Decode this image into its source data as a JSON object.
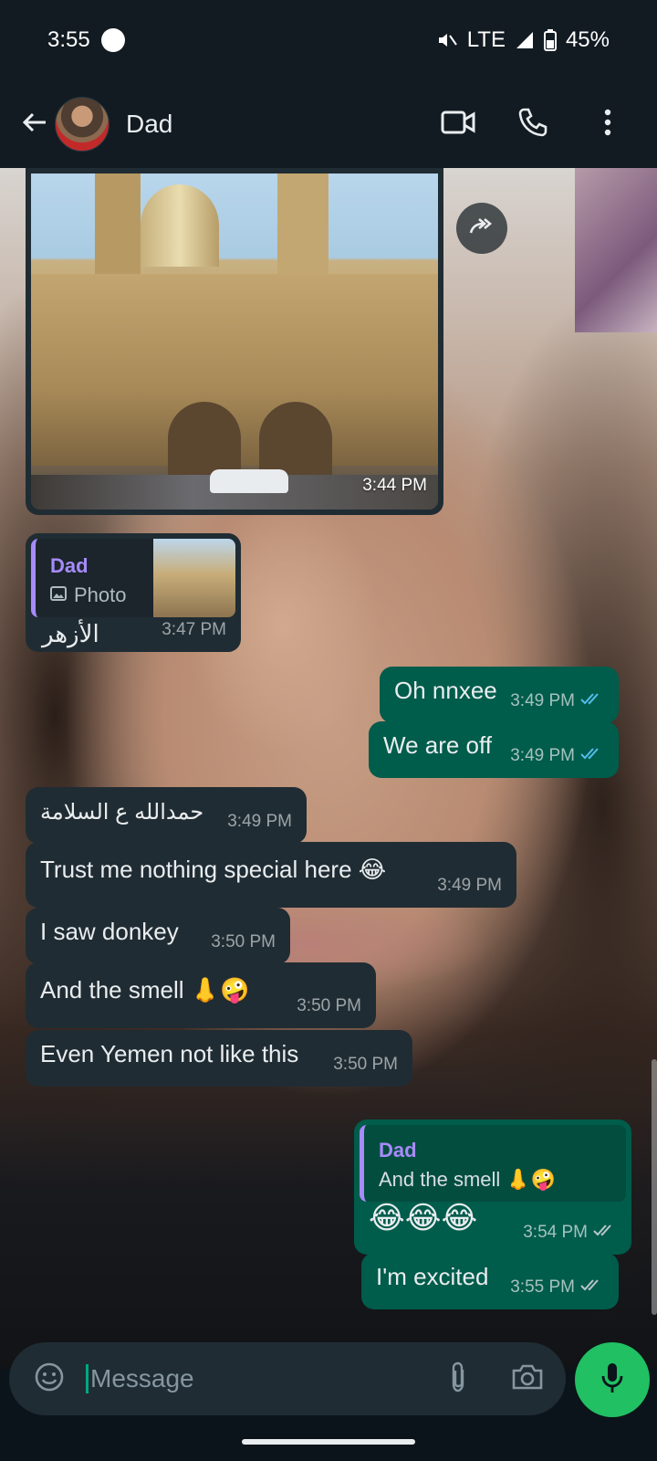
{
  "status_bar": {
    "time": "3:55",
    "network": "LTE",
    "battery": "45%"
  },
  "header": {
    "contact_name": "Dad",
    "icons": [
      "back-arrow-icon",
      "video-call-icon",
      "voice-call-icon",
      "more-options-icon"
    ]
  },
  "messages": [
    {
      "type": "image",
      "direction": "in",
      "time": "3:44 PM"
    },
    {
      "type": "reply",
      "direction": "in",
      "quote_name": "Dad",
      "quote_label": "Photo",
      "text": "الأزهر",
      "time": "3:47 PM"
    },
    {
      "type": "text",
      "direction": "out",
      "text": "Oh nnxee",
      "time": "3:49 PM",
      "status": "read"
    },
    {
      "type": "text",
      "direction": "out",
      "text": "We are off",
      "time": "3:49 PM",
      "status": "read"
    },
    {
      "type": "text",
      "direction": "in",
      "text": "حمدالله ع السلامة",
      "time": "3:49 PM"
    },
    {
      "type": "text",
      "direction": "in",
      "text": "Trust me nothing special here 😂",
      "time": "3:49 PM"
    },
    {
      "type": "text",
      "direction": "in",
      "text": "I saw donkey",
      "time": "3:50 PM"
    },
    {
      "type": "text",
      "direction": "in",
      "text": "And the smell 👃🤪",
      "time": "3:50 PM"
    },
    {
      "type": "text",
      "direction": "in",
      "text": "Even Yemen not like this",
      "time": "3:50 PM"
    },
    {
      "type": "reply",
      "direction": "out",
      "quote_name": "Dad",
      "quote_text": "And the smell 👃🤪",
      "text": "😂😂😂",
      "time": "3:54 PM",
      "status": "delivered"
    },
    {
      "type": "text",
      "direction": "out",
      "text": "I'm excited",
      "time": "3:55 PM",
      "status": "delivered"
    }
  ],
  "input": {
    "placeholder": "Message"
  },
  "colors": {
    "outgoing_bubble": "#005c4b",
    "incoming_bubble": "#202c33",
    "accent": "#21c063",
    "read_ticks": "#53bdeb",
    "quote_bar": "#a78bfa"
  }
}
